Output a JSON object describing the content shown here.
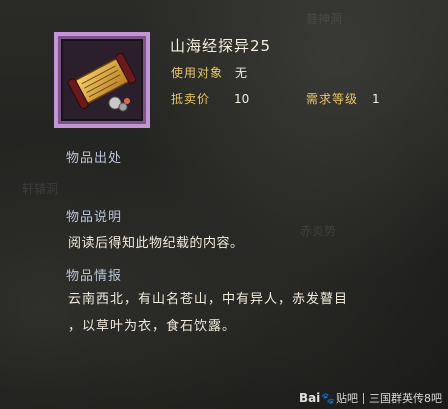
{
  "background": {
    "faint_texts": [
      "普神洞",
      "轩辕洞",
      "赤炎势"
    ]
  },
  "item": {
    "name": "山海经探异25",
    "icon": "scroll-icon",
    "frame_color": "#c394d6",
    "usage_label": "使用对象",
    "usage_value": "无",
    "price_label": "抵卖价",
    "price_value": "10",
    "level_label": "需求等级",
    "level_value": "1"
  },
  "sections": {
    "source_title": "物品出处",
    "description_title": "物品说明",
    "description_text": "阅读后得知此物纪载的内容。",
    "lore_title": "物品情报",
    "lore_line1": "云南西北，有山名苍山，中有异人，赤发瞽目",
    "lore_line2": "，以草叶为衣，食石饮露。"
  },
  "watermark": {
    "logo_text_1": "Bai",
    "logo_paw": "🐾",
    "logo_text_2": "贴吧",
    "forum": "三国群英传8吧"
  },
  "colors": {
    "label_yellow": "#e8c765",
    "section_blue": "#b9c4d8",
    "text_white": "#f1ebdc"
  }
}
